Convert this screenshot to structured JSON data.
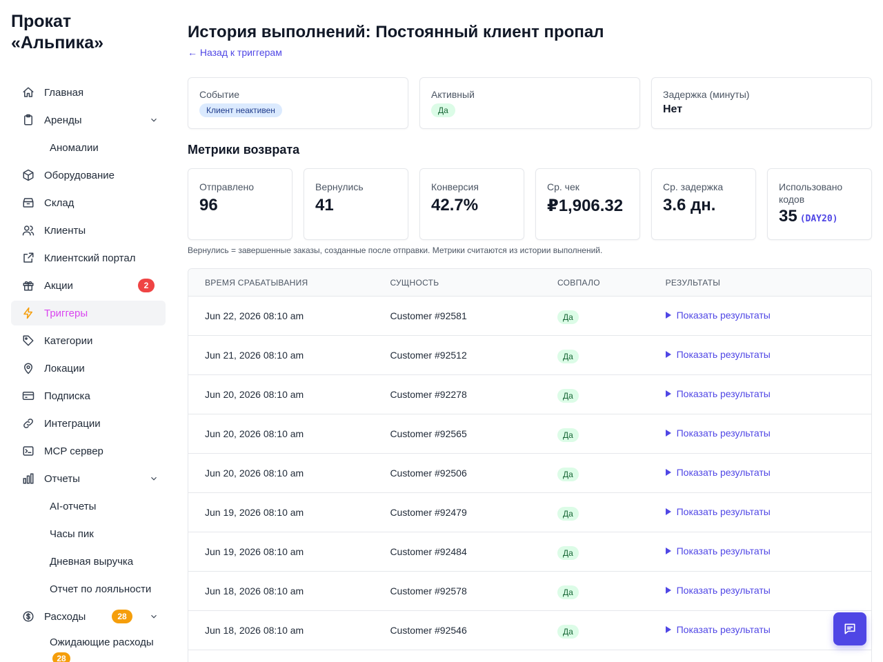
{
  "brand": "Прокат «Альпика»",
  "sidebar": {
    "items": [
      {
        "label": "Главная"
      },
      {
        "label": "Аренды"
      },
      {
        "label": "Аномалии"
      },
      {
        "label": "Оборудование"
      },
      {
        "label": "Склад"
      },
      {
        "label": "Клиенты"
      },
      {
        "label": "Клиентский портал"
      },
      {
        "label": "Акции",
        "badge": "2"
      },
      {
        "label": "Триггеры"
      },
      {
        "label": "Категории"
      },
      {
        "label": "Локации"
      },
      {
        "label": "Подписка"
      },
      {
        "label": "Интеграции"
      },
      {
        "label": "MCP сервер"
      },
      {
        "label": "Отчеты"
      },
      {
        "label": "AI-отчеты"
      },
      {
        "label": "Часы пик"
      },
      {
        "label": "Дневная выручка"
      },
      {
        "label": "Отчет по лояльности"
      },
      {
        "label": "Расходы",
        "badge": "28"
      },
      {
        "label": "Ожидающие расходы",
        "badge": "28"
      }
    ]
  },
  "header": {
    "title": "История выполнений: Постоянный клиент пропал",
    "back_link": "← Назад к триггерам"
  },
  "info": {
    "event_label": "Событие",
    "event_value": "Клиент неактивен",
    "active_label": "Активный",
    "active_value": "Да",
    "delay_label": "Задержка (минуты)",
    "delay_value": "Нет"
  },
  "metrics_title": "Метрики возврата",
  "metrics": [
    {
      "label": "Отправлено",
      "value": "96"
    },
    {
      "label": "Вернулись",
      "value": "41"
    },
    {
      "label": "Конверсия",
      "value": "42.7%"
    },
    {
      "label": "Ср. чек",
      "value": "₽1,906.32"
    },
    {
      "label": "Ср. задержка",
      "value": "3.6 дн."
    },
    {
      "label": "Использовано кодов",
      "value": "35",
      "code": "(DAY20)"
    }
  ],
  "note": "Вернулись = завершенные заказы, созданные после отправки. Метрики считаются из истории выполнений.",
  "table": {
    "headers": [
      "Время срабатывания",
      "Сущность",
      "Совпало",
      "Результаты"
    ],
    "rows": [
      {
        "time": "Jun 22, 2026 08:10 am",
        "entity": "Customer #92581",
        "matched": "Да",
        "action": "Показать результаты"
      },
      {
        "time": "Jun 21, 2026 08:10 am",
        "entity": "Customer #92512",
        "matched": "Да",
        "action": "Показать результаты"
      },
      {
        "time": "Jun 20, 2026 08:10 am",
        "entity": "Customer #92278",
        "matched": "Да",
        "action": "Показать результаты"
      },
      {
        "time": "Jun 20, 2026 08:10 am",
        "entity": "Customer #92565",
        "matched": "Да",
        "action": "Показать результаты"
      },
      {
        "time": "Jun 20, 2026 08:10 am",
        "entity": "Customer #92506",
        "matched": "Да",
        "action": "Показать результаты"
      },
      {
        "time": "Jun 19, 2026 08:10 am",
        "entity": "Customer #92479",
        "matched": "Да",
        "action": "Показать результаты"
      },
      {
        "time": "Jun 19, 2026 08:10 am",
        "entity": "Customer #92484",
        "matched": "Да",
        "action": "Показать результаты"
      },
      {
        "time": "Jun 18, 2026 08:10 am",
        "entity": "Customer #92578",
        "matched": "Да",
        "action": "Показать результаты"
      },
      {
        "time": "Jun 18, 2026 08:10 am",
        "entity": "Customer #92546",
        "matched": "Да",
        "action": "Показать результаты"
      }
    ]
  },
  "colors": {
    "accent": "#4f46e5",
    "active_nav": "#d946ef",
    "badge_red": "#ef4444",
    "badge_orange": "#f59e0b"
  }
}
